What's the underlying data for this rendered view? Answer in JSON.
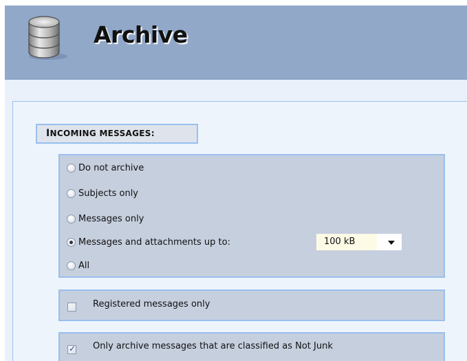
{
  "header": {
    "title": "Archive",
    "icon": "database-icon"
  },
  "incoming": {
    "section_label_cap": "I",
    "section_label_rest": "NCOMING MESSAGES:",
    "options": [
      {
        "label": "Do not archive",
        "checked": false
      },
      {
        "label": "Subjects only",
        "checked": false
      },
      {
        "label": "Messages only",
        "checked": false
      },
      {
        "label": "Messages and attachments up to:",
        "checked": true
      },
      {
        "label": "All",
        "checked": false
      }
    ],
    "size_value": "100 kB",
    "registered_only": {
      "label": "Registered messages only",
      "checked": false
    },
    "not_junk_only": {
      "label": "Only archive messages that are classified as Not Junk",
      "checked": true
    }
  }
}
